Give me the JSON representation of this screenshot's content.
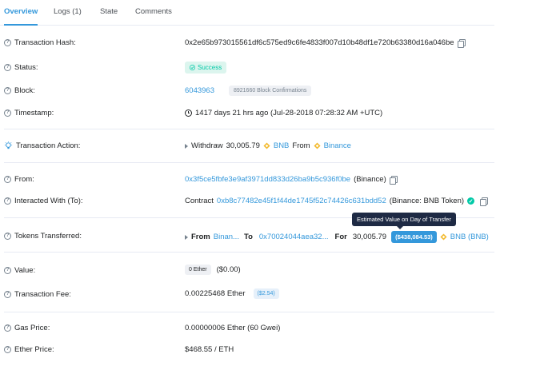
{
  "tabs": [
    {
      "label": "Overview"
    },
    {
      "label": "Logs (1)"
    },
    {
      "label": "State"
    },
    {
      "label": "Comments"
    }
  ],
  "rows": {
    "tx_hash": {
      "label": "Transaction Hash:",
      "value": "0x2e65b973015561df6c575ed9c6fe4833f007d10b48df1e720b63380d16a046be"
    },
    "status": {
      "label": "Status:",
      "value": "Success"
    },
    "block": {
      "label": "Block:",
      "value": "6043963",
      "confirmations": "8921660 Block Confirmations"
    },
    "timestamp": {
      "label": "Timestamp:",
      "value": "1417 days 21 hrs ago (Jul-28-2018 07:28:32 AM +UTC)"
    },
    "action": {
      "label": "Transaction Action:",
      "verb": "Withdraw",
      "amount": "30,005.79",
      "token": "BNB",
      "from_word": "From",
      "source": "Binance"
    },
    "from": {
      "label": "From:",
      "address": "0x3f5ce5fbfe3e9af3971dd833d26ba9b5c936f0be",
      "name": "(Binance)"
    },
    "to": {
      "label": "Interacted With (To):",
      "prefix": "Contract",
      "address": "0xb8c77482e45f1f44de1745f52c74426c631bdd52",
      "name": "(Binance: BNB Token)"
    },
    "tokens": {
      "label": "Tokens Transferred:",
      "from_word": "From",
      "from_value": "Binan...",
      "to_word": "To",
      "to_value": "0x70024044aea32...",
      "for_word": "For",
      "amount": "30,005.79",
      "usd_value": "($438,084.53)",
      "token": "BNB (BNB)",
      "tooltip": "Estimated Value on Day of Transfer"
    },
    "value": {
      "label": "Value:",
      "ether": "0 Ether",
      "usd": "($0.00)"
    },
    "fee": {
      "label": "Transaction Fee:",
      "value": "0.00225468 Ether",
      "usd": "($2.54)"
    },
    "gas": {
      "label": "Gas Price:",
      "value": "0.00000006 Ether (60 Gwei)"
    },
    "ether_price": {
      "label": "Ether Price:",
      "value": "$468.55 / ETH"
    }
  },
  "icons": {
    "help": "question-circle-icon",
    "action": "lightbulb-icon",
    "copy": "copy-icon",
    "clock": "clock-icon",
    "token": "bnb-token-icon",
    "verified": "check-circle-icon"
  },
  "colors": {
    "link": "#3498db",
    "success": "#00c9a7",
    "tooltip_bg": "#1e2a44",
    "bnb": "#f3ba2f"
  }
}
